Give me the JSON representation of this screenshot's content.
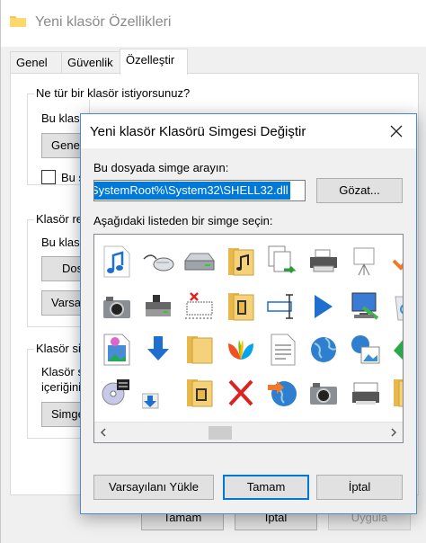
{
  "back_window": {
    "title": "Yeni klasör Özellikleri",
    "tabs": [
      "Genel",
      "Güvenlik",
      "Özelleştir"
    ],
    "group1_label": "Ne tür bir klasör istiyorsunuz?",
    "group1_sub": "Bu klas",
    "group1_button": "Genel",
    "group1_check_label": "Bu ş",
    "group2_label": "Klasör re",
    "group2_sub": "Bu klas",
    "group2_button1": "Dos",
    "group2_button2": "Varsa",
    "group3_label": "Klasör si",
    "group3_sub1": "Klasör s",
    "group3_sub2": "içeriğini",
    "group3_button": "Simge",
    "ok_label": "Tamam",
    "cancel_label": "İptal",
    "apply_label": "Uygula"
  },
  "dialog": {
    "title": "Yeni klasör Klasörü Simgesi Değiştir",
    "file_label": "Bu dosyada simge arayın:",
    "file_value": "SystemRoot%\\System32\\SHELL32.dll",
    "browse_label": "Gözat...",
    "list_label": "Aşağıdaki listeden bir simge seçin:",
    "restore_label": "Varsayılanı Yükle",
    "ok_label": "Tamam",
    "cancel_label": "İptal"
  },
  "icons": [
    [
      "music-note-icon",
      "mouse-icon",
      "drive-icon",
      "music-folder-icon",
      "file-copy-icon",
      "printer-icon",
      "presentation-icon",
      "checkmark-icon"
    ],
    [
      "camera-icon",
      "drive-stack-icon",
      "network-drive-icon",
      "video-folder-icon",
      "text-cursor-icon",
      "play-icon",
      "display-settings-icon",
      "recycle-bin-icon"
    ],
    [
      "photo-file-icon",
      "download-arrow-icon",
      "folder-icon",
      "windows-butterfly-icon",
      "document-icon",
      "globe-icon",
      "globe-picture-icon",
      "green-arrow-icon"
    ],
    [
      "cd-icon",
      "download-small-icon",
      "music-folder-2-icon",
      "red-x-icon",
      "globe-arrow-icon",
      "camera-2-icon",
      "scanner-icon",
      "folder-partial-icon"
    ]
  ]
}
